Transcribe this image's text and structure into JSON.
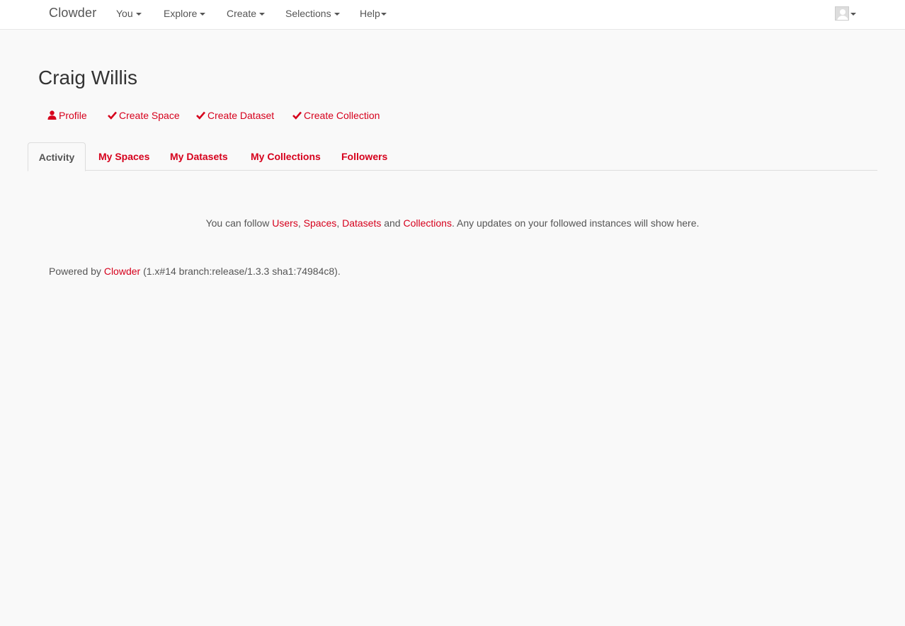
{
  "navbar": {
    "brand": "Clowder",
    "items": [
      {
        "label": "You"
      },
      {
        "label": "Explore"
      },
      {
        "label": "Create"
      },
      {
        "label": "Selections"
      },
      {
        "label": "Help"
      }
    ]
  },
  "user": {
    "name": "Craig Willis"
  },
  "actions": [
    {
      "label": "Profile",
      "icon": "user-icon"
    },
    {
      "label": "Create Space",
      "icon": "check-icon"
    },
    {
      "label": "Create Dataset",
      "icon": "check-icon"
    },
    {
      "label": "Create Collection",
      "icon": "check-icon"
    }
  ],
  "tabs": [
    {
      "label": "Activity",
      "active": true
    },
    {
      "label": "My Spaces",
      "active": false
    },
    {
      "label": "My Datasets",
      "active": false
    },
    {
      "label": "My Collections",
      "active": false
    },
    {
      "label": "Followers",
      "active": false
    }
  ],
  "activity": {
    "prefix": "You can follow ",
    "link_users": "Users",
    "sep1": ", ",
    "link_spaces": "Spaces",
    "sep2": ", ",
    "link_datasets": "Datasets",
    "sep3": " and ",
    "link_collections": "Collections",
    "suffix": ". Any updates on your followed instances will show here."
  },
  "footer": {
    "prefix": "Powered by ",
    "link": "Clowder",
    "suffix": " (1.x#14 branch:release/1.3.3 sha1:74984c8)."
  },
  "colors": {
    "accent": "#d6001c",
    "text": "#555555",
    "background": "#f9f9f9"
  }
}
